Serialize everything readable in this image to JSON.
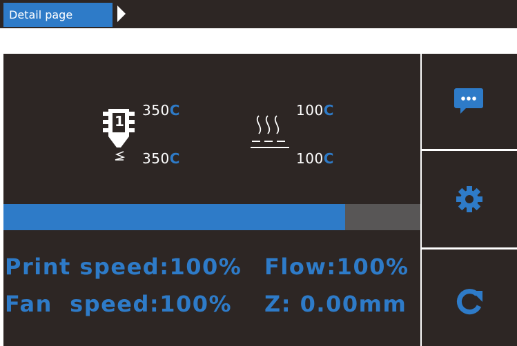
{
  "header": {
    "breadcrumb": "Detail page"
  },
  "extruder": {
    "number": "1",
    "current_value": "350",
    "current_unit": "C",
    "target_value": "350",
    "target_unit": "C"
  },
  "bed": {
    "current_value": "100",
    "current_unit": "C",
    "target_value": "100",
    "target_unit": "C"
  },
  "progress": {
    "percent": 82
  },
  "stats": {
    "print_speed": "Print speed:100%",
    "flow": "Flow:100%",
    "fan_speed": "Fan  speed:100%",
    "z": "Z: 0.00mm"
  },
  "sidebar": {
    "buttons": [
      {
        "icon": "message-icon"
      },
      {
        "icon": "gear-icon"
      },
      {
        "icon": "refresh-icon"
      }
    ]
  },
  "colors": {
    "accent": "#2e7bc8",
    "background": "#2d2624",
    "progress_track": "#585656"
  }
}
